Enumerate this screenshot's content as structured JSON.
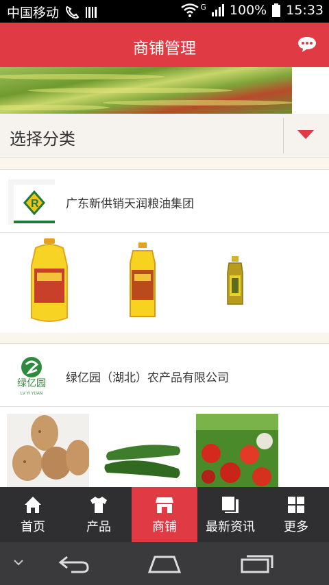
{
  "status_bar": {
    "carrier": "中国移动",
    "network_label": "G",
    "battery": "100%",
    "time": "15:33"
  },
  "header": {
    "title": "商铺管理"
  },
  "category": {
    "label": "选择分类"
  },
  "shops": [
    {
      "name": "广东新供销天润粮油集团",
      "products": [
        "large-oil-bottle",
        "medium-oil-bottle",
        "small-oil-bottle"
      ]
    },
    {
      "name": "绿亿园（湖北）农产品有限公司",
      "logo_text": "绿亿园",
      "logo_subtext": "LV YI YUAN",
      "products": [
        "potatoes",
        "cucumbers",
        "tomatoes"
      ]
    }
  ],
  "tabs": [
    {
      "label": "首页",
      "icon": "home-icon"
    },
    {
      "label": "产品",
      "icon": "shirt-icon"
    },
    {
      "label": "商铺",
      "icon": "store-icon"
    },
    {
      "label": "最新资讯",
      "icon": "news-icon"
    },
    {
      "label": "更多",
      "icon": "grid-icon"
    }
  ],
  "colors": {
    "accent": "#e03a45",
    "tabbar_bg": "#2f2f31",
    "navbar_bg": "#3a3a3c"
  }
}
